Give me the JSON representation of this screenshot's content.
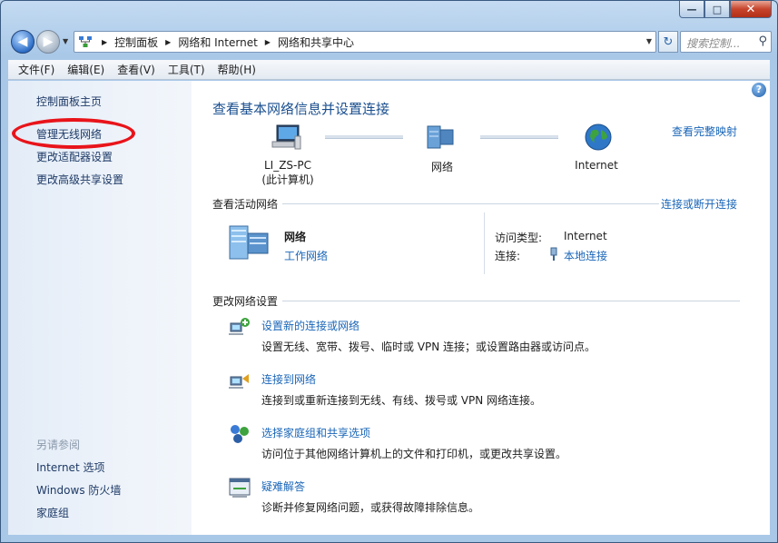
{
  "window": {
    "minimize_glyph": "—",
    "maximize_glyph": "□",
    "close_glyph": "✕"
  },
  "nav": {
    "back_glyph": "◀",
    "forward_glyph": "▶",
    "breadcrumbs": [
      "控制面板",
      "网络和 Internet",
      "网络和共享中心"
    ],
    "refresh_glyph": "↻",
    "search_placeholder": "搜索控制...",
    "search_glyph": "⚲"
  },
  "menu": [
    "文件(F)",
    "编辑(E)",
    "查看(V)",
    "工具(T)",
    "帮助(H)"
  ],
  "sidebar": {
    "home": "控制面板主页",
    "links": [
      "管理无线网络",
      "更改适配器设置",
      "更改高级共享设置"
    ],
    "see_also_title": "另请参阅",
    "see_also": [
      "Internet 选项",
      "Windows 防火墙",
      "家庭组"
    ]
  },
  "main": {
    "help_glyph": "?",
    "title": "查看基本网络信息并设置连接",
    "full_map_link": "查看完整映射",
    "nodes": [
      {
        "label": "LI_ZS-PC",
        "sublabel": "(此计算机)"
      },
      {
        "label": "网络",
        "sublabel": ""
      },
      {
        "label": "Internet",
        "sublabel": ""
      }
    ],
    "active_section": "查看活动网络",
    "connect_disconnect": "连接或断开连接",
    "active_network": {
      "name": "网络",
      "type_link": "工作网络",
      "access_type_label": "访问类型:",
      "access_type_value": "Internet",
      "connection_label": "连接:",
      "connection_value": "本地连接"
    },
    "change_section": "更改网络设置",
    "tasks": [
      {
        "title": "设置新的连接或网络",
        "desc": "设置无线、宽带、拨号、临时或 VPN 连接；或设置路由器或访问点。",
        "icon": "new-connection-icon"
      },
      {
        "title": "连接到网络",
        "desc": "连接到或重新连接到无线、有线、拨号或 VPN 网络连接。",
        "icon": "connect-network-icon"
      },
      {
        "title": "选择家庭组和共享选项",
        "desc": "访问位于其他网络计算机上的文件和打印机，或更改共享设置。",
        "icon": "homegroup-icon"
      },
      {
        "title": "疑难解答",
        "desc": "诊断并修复网络问题，或获得故障排除信息。",
        "icon": "troubleshoot-icon"
      }
    ]
  }
}
